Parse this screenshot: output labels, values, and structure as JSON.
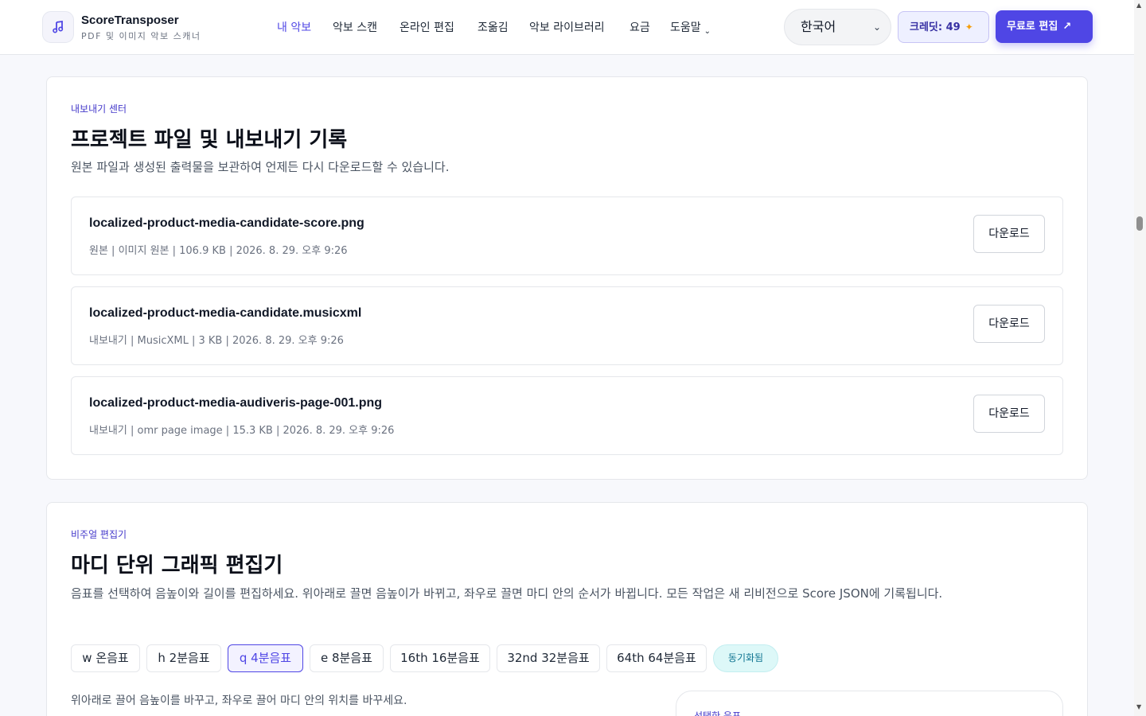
{
  "header": {
    "brand_name": "ScoreTransposer",
    "brand_sub": "PDF 및 이미지 악보 스캐너",
    "nav": [
      {
        "label": "내 악보",
        "active": true
      },
      {
        "label": "악보 스캔"
      },
      {
        "label": "온라인 편집"
      },
      {
        "label": "조옮김"
      },
      {
        "label": "악보 라이브러리"
      },
      {
        "label": "요금"
      },
      {
        "label": "도움말",
        "has_dropdown": true
      }
    ],
    "language": "한국어",
    "credits_label": "크레딧: 49",
    "cta_label": "무료로 편집",
    "accent_color": "#4f46e5"
  },
  "export_center": {
    "eyebrow": "내보내기 센터",
    "title": "프로젝트 파일 및 내보내기 기록",
    "description": "원본 파일과 생성된 출력물을 보관하여 언제든 다시 다운로드할 수 있습니다.",
    "files": [
      {
        "name": "localized-product-media-candidate-score.png",
        "meta": "원본 | 이미지 원본 | 106.9 KB | 2026. 8. 29. 오후 9:26",
        "button": "다운로드"
      },
      {
        "name": "localized-product-media-candidate.musicxml",
        "meta": "내보내기 | MusicXML | 3 KB | 2026. 8. 29. 오후 9:26",
        "button": "다운로드"
      },
      {
        "name": "localized-product-media-audiveris-page-001.png",
        "meta": "내보내기 | omr page image | 15.3 KB | 2026. 8. 29. 오후 9:26",
        "button": "다운로드"
      }
    ]
  },
  "editor": {
    "eyebrow": "비주얼 편집기",
    "title": "마디 단위 그래픽 편집기",
    "description": "음표를 선택하여 음높이와 길이를 편집하세요. 위아래로 끌면 음높이가 바뀌고, 좌우로 끌면 마디 안의 순서가 바뀝니다. 모든 작업은 새 리비전으로 Score JSON에 기록됩니다.",
    "durations": [
      {
        "label": "w 온음표"
      },
      {
        "label": "h 2분음표"
      },
      {
        "label": "q 4분음표",
        "active": true
      },
      {
        "label": "e 8분음표"
      },
      {
        "label": "16th 16분음표"
      },
      {
        "label": "32nd 32분음표"
      },
      {
        "label": "64th 64분음표"
      }
    ],
    "sync_status": "동기화됨",
    "hint": "위아래로 끌어 음높이를 바꾸고, 좌우로 끌어 마디 안의 위치를 바꾸세요.",
    "side_panel_label": "선택한 음표"
  }
}
